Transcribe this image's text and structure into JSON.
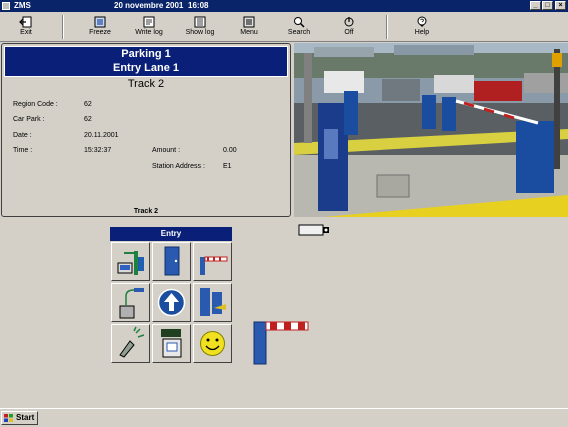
{
  "window": {
    "app_name": "ZMS",
    "date": "20 novembre 2001",
    "time": "16:08",
    "controls": {
      "minimize": "_",
      "maximize": "□",
      "close": "×"
    }
  },
  "toolbar": {
    "buttons": [
      {
        "label": "Exit",
        "icon": "exit-icon"
      },
      {
        "label": "Freeze",
        "icon": "freeze-icon"
      },
      {
        "label": "Write log",
        "icon": "write-log-icon"
      },
      {
        "label": "Show log",
        "icon": "show-log-icon"
      },
      {
        "label": "Menu",
        "icon": "menu-icon"
      },
      {
        "label": "Search",
        "icon": "search-icon"
      },
      {
        "label": "Off",
        "icon": "power-icon"
      },
      {
        "label": "Help",
        "icon": "help-icon"
      }
    ]
  },
  "panel": {
    "title_line1": "Parking 1",
    "title_line2": "Entry Lane 1",
    "track_title": "Track 2",
    "fields": {
      "region_code_label": "Region Code :",
      "region_code_value": "62",
      "car_park_label": "Car Park :",
      "car_park_value": "62",
      "date_label": "Date :",
      "date_value": "20.11.2001",
      "time_label": "Time :",
      "time_value": "15:32:37",
      "amount_label": "Amount :",
      "amount_value": "0.00",
      "station_label": "Station Address :",
      "station_value": "E1"
    },
    "footer": "Track 2"
  },
  "entry": {
    "title": "Entry",
    "cells": [
      "ticket-dispenser-icon",
      "door-icon",
      "barrier-icon",
      "card-reader-icon",
      "up-arrow-icon",
      "terminal-icon",
      "intercom-icon",
      "ticket-printer-icon",
      "smiley-icon"
    ]
  },
  "taskbar": {
    "start_label": "Start"
  },
  "colors": {
    "title_bar": "#0a246a",
    "panel_head": "#0a1f78",
    "background": "#d4d0c8"
  }
}
